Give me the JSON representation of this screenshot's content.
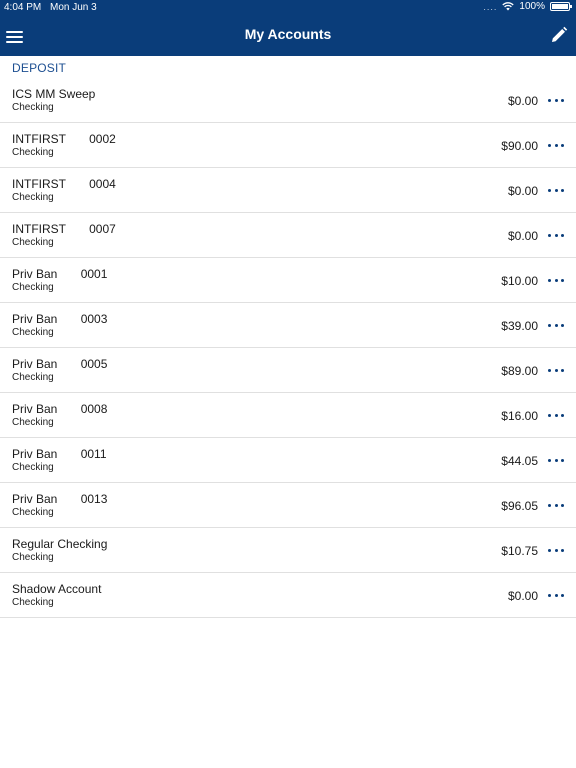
{
  "status_bar": {
    "time": "4:04 PM",
    "date": "Mon Jun 3",
    "signal": "....",
    "battery": "100%"
  },
  "nav": {
    "title": "My Accounts",
    "menu_icon": "hamburger-menu-icon",
    "edit_icon": "pencil-icon"
  },
  "colors": {
    "header_bg": "#0a3d7a",
    "section_text": "#1d4f91",
    "more_dots": "#0a3d7a"
  },
  "section": {
    "label": "DEPOSIT"
  },
  "accounts": [
    {
      "name": "ICS MM Sweep",
      "type": "Checking",
      "balance": "$0.00"
    },
    {
      "name": "INTFIRST       0002",
      "type": "Checking",
      "balance": "$90.00"
    },
    {
      "name": "INTFIRST       0004",
      "type": "Checking",
      "balance": "$0.00"
    },
    {
      "name": "INTFIRST       0007",
      "type": "Checking",
      "balance": "$0.00"
    },
    {
      "name": "Priv Ban       0001",
      "type": "Checking",
      "balance": "$10.00"
    },
    {
      "name": "Priv Ban       0003",
      "type": "Checking",
      "balance": "$39.00"
    },
    {
      "name": "Priv Ban       0005",
      "type": "Checking",
      "balance": "$89.00"
    },
    {
      "name": "Priv Ban       0008",
      "type": "Checking",
      "balance": "$16.00"
    },
    {
      "name": "Priv Ban       0011",
      "type": "Checking",
      "balance": "$44.05"
    },
    {
      "name": "Priv Ban       0013",
      "type": "Checking",
      "balance": "$96.05"
    },
    {
      "name": "Regular Checking",
      "type": "Checking",
      "balance": "$10.75"
    },
    {
      "name": "Shadow Account",
      "type": "Checking",
      "balance": "$0.00"
    }
  ]
}
